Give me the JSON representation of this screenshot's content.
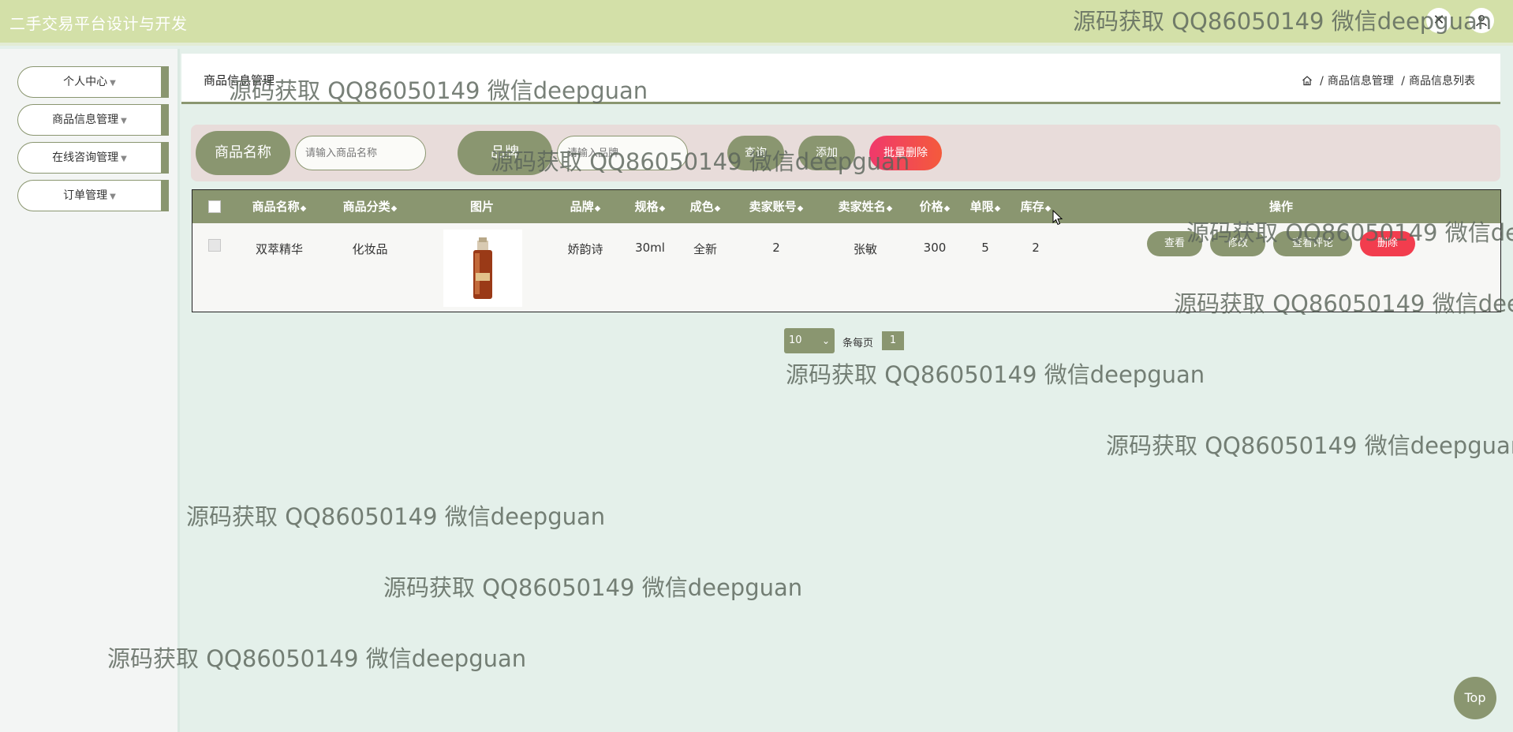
{
  "app": {
    "title": "二手交易平台设计与开发"
  },
  "header_icons": [
    "close-icon",
    "user-icon"
  ],
  "sidebar": {
    "items": [
      {
        "label": "个人中心"
      },
      {
        "label": "商品信息管理"
      },
      {
        "label": "在线咨询管理"
      },
      {
        "label": "订单管理"
      }
    ]
  },
  "main": {
    "title": "商品信息管理",
    "breadcrumb": [
      "商品信息管理",
      "商品信息列表"
    ]
  },
  "search": {
    "name_label": "商品名称",
    "name_placeholder": "请输入商品名称",
    "brand_label": "品牌",
    "brand_placeholder": "请输入品牌",
    "query_button": "查询",
    "add_button": "添加",
    "batch_delete_button": "批量删除"
  },
  "table": {
    "columns": [
      "商品名称",
      "商品分类",
      "图片",
      "品牌",
      "规格",
      "成色",
      "卖家账号",
      "卖家姓名",
      "价格",
      "单限",
      "库存",
      "操作"
    ],
    "rows": [
      {
        "name": "双萃精华",
        "category": "化妆品",
        "brand": "娇韵诗",
        "spec": "30ml",
        "condition": "全新",
        "seller_account": "2",
        "seller_name": "张敏",
        "price": "300",
        "limit": "5",
        "stock": "2"
      }
    ],
    "row_actions": [
      "查看",
      "修改",
      "查看评论",
      "删除"
    ]
  },
  "pagination": {
    "page_size": "10",
    "per_page_text": "条每页",
    "current_page": "1"
  },
  "watermark": "源码获取 QQ86050149 微信deepguan",
  "back_to_top": "Top",
  "colors": {
    "accent": "#8a9670",
    "topbar": "#d3e0a8",
    "danger": "#f23d4e",
    "page_bg": "#e4f0ea"
  }
}
